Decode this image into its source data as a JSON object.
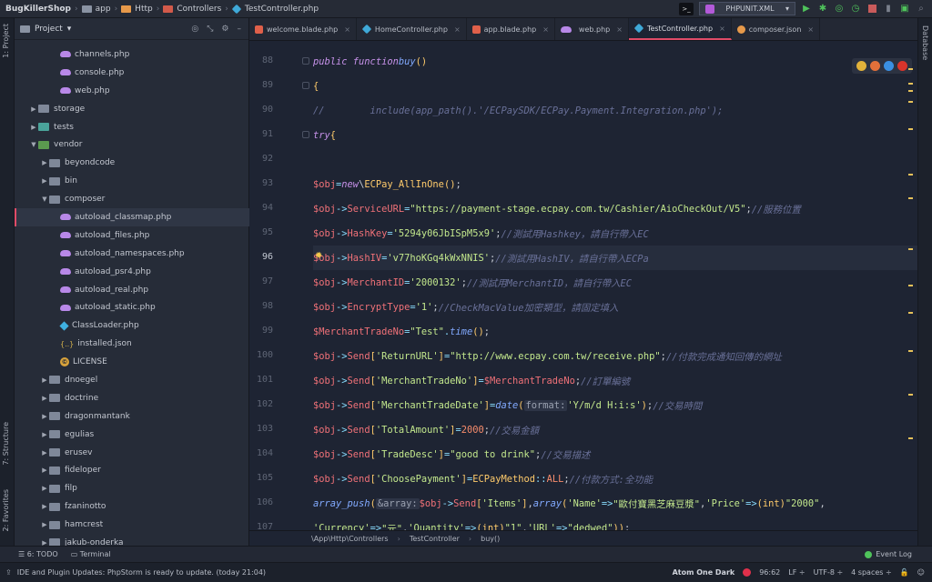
{
  "breadcrumb": [
    "BugKillerShop",
    "app",
    "Http",
    "Controllers",
    "TestController.php"
  ],
  "run_config": "PHPUNIT.XML",
  "left_tabs": {
    "project": "1: Project",
    "structure": "7: Structure",
    "favorites": "2: Favorites"
  },
  "right_tabs": {
    "database": "Database"
  },
  "project_panel": {
    "title": "Project",
    "tree": [
      {
        "label": "channels.php",
        "indent": 3,
        "icon": "php",
        "arrow": ""
      },
      {
        "label": "console.php",
        "indent": 3,
        "icon": "php",
        "arrow": ""
      },
      {
        "label": "web.php",
        "indent": 3,
        "icon": "php",
        "arrow": ""
      },
      {
        "label": "storage",
        "indent": 1,
        "icon": "folder",
        "arrow": "▶"
      },
      {
        "label": "tests",
        "indent": 1,
        "icon": "folder-teal",
        "arrow": "▶"
      },
      {
        "label": "vendor",
        "indent": 1,
        "icon": "folder-green",
        "arrow": "▼"
      },
      {
        "label": "beyondcode",
        "indent": 2,
        "icon": "folder",
        "arrow": "▶"
      },
      {
        "label": "bin",
        "indent": 2,
        "icon": "folder",
        "arrow": "▶"
      },
      {
        "label": "composer",
        "indent": 2,
        "icon": "folder",
        "arrow": "▼"
      },
      {
        "label": "autoload_classmap.php",
        "indent": 3,
        "icon": "php",
        "arrow": "",
        "selected": true
      },
      {
        "label": "autoload_files.php",
        "indent": 3,
        "icon": "php",
        "arrow": ""
      },
      {
        "label": "autoload_namespaces.php",
        "indent": 3,
        "icon": "php",
        "arrow": ""
      },
      {
        "label": "autoload_psr4.php",
        "indent": 3,
        "icon": "php",
        "arrow": ""
      },
      {
        "label": "autoload_real.php",
        "indent": 3,
        "icon": "php",
        "arrow": ""
      },
      {
        "label": "autoload_static.php",
        "indent": 3,
        "icon": "php",
        "arrow": ""
      },
      {
        "label": "ClassLoader.php",
        "indent": 3,
        "icon": "class",
        "arrow": ""
      },
      {
        "label": "installed.json",
        "indent": 3,
        "icon": "json",
        "arrow": ""
      },
      {
        "label": "LICENSE",
        "indent": 3,
        "icon": "license",
        "arrow": ""
      },
      {
        "label": "dnoegel",
        "indent": 2,
        "icon": "folder",
        "arrow": "▶"
      },
      {
        "label": "doctrine",
        "indent": 2,
        "icon": "folder",
        "arrow": "▶"
      },
      {
        "label": "dragonmantank",
        "indent": 2,
        "icon": "folder",
        "arrow": "▶"
      },
      {
        "label": "egulias",
        "indent": 2,
        "icon": "folder",
        "arrow": "▶"
      },
      {
        "label": "erusev",
        "indent": 2,
        "icon": "folder",
        "arrow": "▶"
      },
      {
        "label": "fideloper",
        "indent": 2,
        "icon": "folder",
        "arrow": "▶"
      },
      {
        "label": "filp",
        "indent": 2,
        "icon": "folder",
        "arrow": "▶"
      },
      {
        "label": "fzaninotto",
        "indent": 2,
        "icon": "folder",
        "arrow": "▶"
      },
      {
        "label": "hamcrest",
        "indent": 2,
        "icon": "folder",
        "arrow": "▶"
      },
      {
        "label": "jakub-onderka",
        "indent": 2,
        "icon": "folder",
        "arrow": "▶"
      }
    ]
  },
  "tabs": [
    {
      "label": "welcome.blade.php",
      "icon": "laravel"
    },
    {
      "label": "HomeController.php",
      "icon": "php"
    },
    {
      "label": "app.blade.php",
      "icon": "laravel"
    },
    {
      "label": "web.php",
      "icon": "elephant"
    },
    {
      "label": "TestController.php",
      "icon": "php",
      "active": true
    },
    {
      "label": "composer.json",
      "icon": "composer"
    }
  ],
  "code": {
    "current_line": "96",
    "lines": [
      {
        "n": "88",
        "html": "    <span class='kw'>public function</span> <span class='fn'>buy</span> <span class='cls-n'>()</span>"
      },
      {
        "n": "89",
        "html": "    <span class='cls-n'>{</span>"
      },
      {
        "n": "90",
        "html": "<span class='cm'>//        include(app_path().'/ECPaySDK/ECPay.Payment.Integration.php');</span>"
      },
      {
        "n": "91",
        "html": "        <span class='kw'>try</span> <span class='cls-n'>{</span>"
      },
      {
        "n": "92",
        "html": ""
      },
      {
        "n": "93",
        "html": "            <span class='var'>$obj</span><span class='op'>=</span> <span class='kw'>new</span> <span class='txt'>\\</span><span class='cls-n'>ECPay_AllInOne</span><span class='cls-n'>()</span><span class='txt'>;</span>"
      },
      {
        "n": "94",
        "html": "            <span class='var'>$obj</span><span class='op'>-&gt;</span><span class='var'>ServiceURL</span>  <span class='op'>=</span> <span class='str'>\"https://payment-stage.ecpay.com.tw/Cashier/AioCheckOut/V5\"</span><span class='txt'>;</span>  <span class='cm'>//服務位置</span>"
      },
      {
        "n": "95",
        "html": "            <span class='var'>$obj</span><span class='op'>-&gt;</span><span class='var'>HashKey</span>     <span class='op'>=</span> <span class='str'>'5294y06JbISpM5x9'</span> <span class='txt'>;</span>                   <span class='cm'>//測試用Hashkey，請自行帶入EC</span>"
      },
      {
        "n": "96",
        "html": "            <span class='var'>$obj</span><span class='op'>-&gt;</span><span class='var'>HashIV</span>      <span class='op'>=</span> <span class='str'>'v77hoKGq4kWxNNIS'</span> <span class='txt'>;</span>                   <span class='cm'>//測試用HashIV，請自行帶入ECPa</span>"
      },
      {
        "n": "97",
        "html": "            <span class='var'>$obj</span><span class='op'>-&gt;</span><span class='var'>MerchantID</span>  <span class='op'>=</span> <span class='str'>'2000132'</span><span class='txt'>;</span>                        <span class='cm'>//測試用MerchantID，請自行帶入EC</span>"
      },
      {
        "n": "98",
        "html": "            <span class='var'>$obj</span><span class='op'>-&gt;</span><span class='var'>EncryptType</span> <span class='op'>=</span> <span class='str'>'1'</span><span class='txt'>;</span>                         <span class='cm'>//CheckMacValue加密類型，請固定填入</span>"
      },
      {
        "n": "99",
        "html": "            <span class='var'>$MerchantTradeNo</span> <span class='op'>=</span> <span class='str'>\"Test\"</span><span class='op'>.</span><span class='fn'>time</span><span class='cls-n'>()</span> <span class='txt'>;</span>"
      },
      {
        "n": "100",
        "html": "            <span class='var'>$obj</span><span class='op'>-&gt;</span><span class='var'>Send</span><span class='cls-n'>[</span><span class='str'>'ReturnURL'</span><span class='cls-n'>]</span>        <span class='op'>=</span> <span class='str'>\"http://www.ecpay.com.tw/receive.php\"</span> <span class='txt'>;</span>    <span class='cm'>//付款完成通知回傳的網址</span>"
      },
      {
        "n": "101",
        "html": "            <span class='var'>$obj</span><span class='op'>-&gt;</span><span class='var'>Send</span><span class='cls-n'>[</span><span class='str'>'MerchantTradeNo'</span><span class='cls-n'>]</span>  <span class='op'>=</span> <span class='var'>$MerchantTradeNo</span><span class='txt'>;</span>                <span class='cm'>//訂單編號</span>"
      },
      {
        "n": "102",
        "html": "            <span class='var'>$obj</span><span class='op'>-&gt;</span><span class='var'>Send</span><span class='cls-n'>[</span><span class='str'>'MerchantTradeDate'</span><span class='cls-n'>]</span> <span class='op'>=</span> <span class='fn'>date</span><span class='cls-n'>(</span> <span class='hint'>format:</span> <span class='str'>'Y/m/d H:i:s'</span><span class='cls-n'>)</span><span class='txt'>;</span>                <span class='cm'>//交易時間</span>"
      },
      {
        "n": "103",
        "html": "            <span class='var'>$obj</span><span class='op'>-&gt;</span><span class='var'>Send</span><span class='cls-n'>[</span><span class='str'>'TotalAmount'</span><span class='cls-n'>]</span>      <span class='op'>=</span> <span class='num'>2000</span><span class='txt'>;</span>                             <span class='cm'>//交易金額</span>"
      },
      {
        "n": "104",
        "html": "            <span class='var'>$obj</span><span class='op'>-&gt;</span><span class='var'>Send</span><span class='cls-n'>[</span><span class='str'>'TradeDesc'</span><span class='cls-n'>]</span>        <span class='op'>=</span> <span class='str'>\"good to drink\"</span> <span class='txt'>;</span>                   <span class='cm'>//交易描述</span>"
      },
      {
        "n": "105",
        "html": "            <span class='var'>$obj</span><span class='op'>-&gt;</span><span class='var'>Send</span><span class='cls-n'>[</span><span class='str'>'ChoosePayment'</span><span class='cls-n'>]</span>    <span class='op'>=</span> <span class='cls-n'>ECPayMethod</span><span class='op'>::</span><span class='num'>ALL</span> <span class='txt'>;</span>                <span class='cm'>//付款方式:全功能</span>"
      },
      {
        "n": "106",
        "html": "            <span class='fn'>array_push</span><span class='cls-n'>(</span><span class='hint'>&amp;array:</span> <span class='var'>$obj</span><span class='op'>-&gt;</span><span class='var'>Send</span><span class='cls-n'>[</span><span class='str'>'Items'</span><span class='cls-n'>]</span><span class='txt'>,</span> <span class='fn'>array</span><span class='cls-n'>(</span><span class='str'>'Name'</span> <span class='op'>=&gt;</span> <span class='str'>\"歐付寶黑芝麻豆漿\"</span><span class='txt'>,</span> <span class='str'>'Price'</span> <span class='op'>=&gt;</span> <span class='cls-n'>(int)</span><span class='str'>\"2000\"</span><span class='txt'>,</span>"
      },
      {
        "n": "107",
        "html": "                <span class='str'>'Currency'</span> <span class='op'>=&gt;</span> <span class='str'>\"元\"</span><span class='txt'>,</span> <span class='str'>'Quantity'</span> <span class='op'>=&gt;</span> <span class='cls-n'>(int)</span> <span class='str'>\"1\"</span><span class='txt'>,</span> <span class='str'>'URL'</span> <span class='op'>=&gt;</span> <span class='str'>\"dedwed\"</span><span class='cls-n'>))</span><span class='txt'>;</span>"
      }
    ]
  },
  "nav": [
    "\\App\\Http\\Controllers",
    "TestController",
    "buy()"
  ],
  "toolwindows": {
    "todo": "6: TODO",
    "terminal": "Terminal",
    "eventlog": "Event Log"
  },
  "status": {
    "message": "IDE and Plugin Updates: PhpStorm is ready to update. (today 21:04)",
    "theme": "Atom One Dark",
    "position": "96:62",
    "line_sep": "LF ÷",
    "encoding": "UTF-8 ÷",
    "indent": "4 spaces ÷"
  },
  "colors": {
    "accent": "#e04b68",
    "background": "#1e2433",
    "panel": "#262c38"
  }
}
